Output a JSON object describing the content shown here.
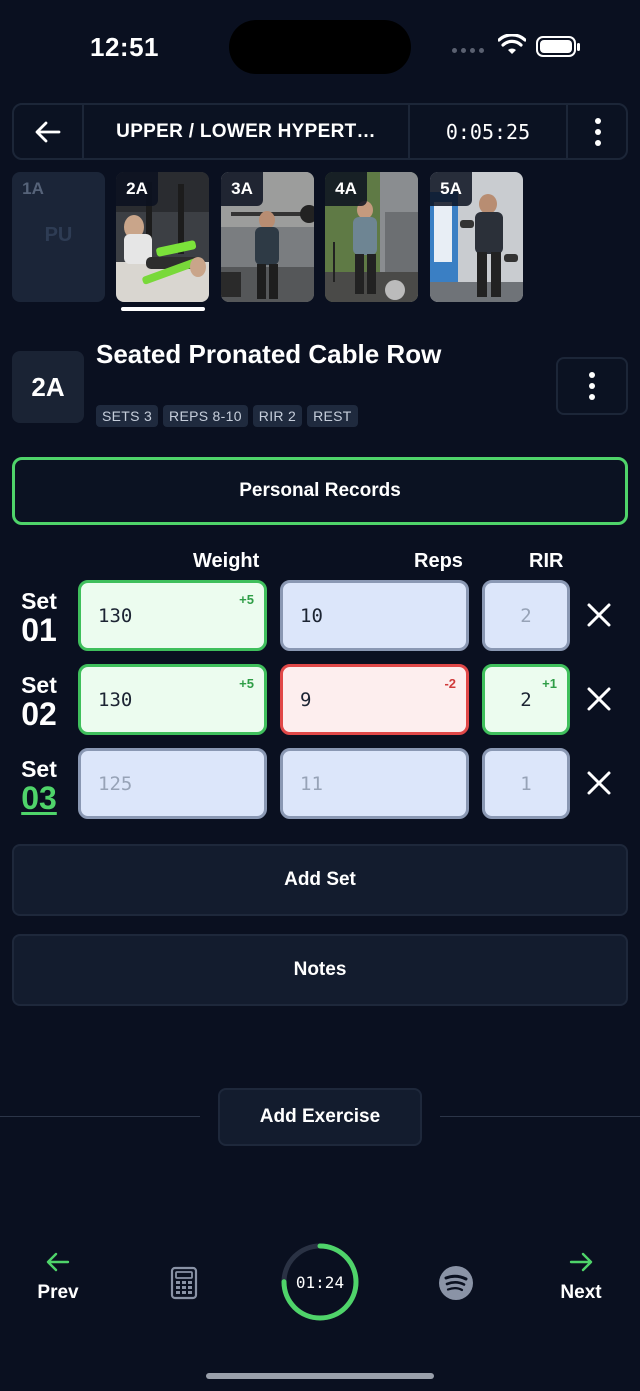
{
  "status_bar": {
    "time": "12:51"
  },
  "header": {
    "title": "UPPER / LOWER HYPERT…",
    "elapsed": "0:05:25"
  },
  "exercises": [
    {
      "label": "1A",
      "placeholder": "PU"
    },
    {
      "label": "2A"
    },
    {
      "label": "3A"
    },
    {
      "label": "4A"
    },
    {
      "label": "5A"
    }
  ],
  "current_exercise": {
    "badge": "2A",
    "name": "Seated Pronated Cable Row",
    "tags": [
      "SETS 3",
      "REPS 8-10",
      "RIR 2",
      "REST"
    ]
  },
  "personal_records_label": "Personal Records",
  "columns": {
    "weight": "Weight",
    "reps": "Reps",
    "rir": "RIR"
  },
  "sets": [
    {
      "word": "Set",
      "number": "01",
      "weight": "130",
      "weight_delta": "+5",
      "reps": "10",
      "reps_delta": "",
      "rir": "2",
      "rir_delta": ""
    },
    {
      "word": "Set",
      "number": "02",
      "weight": "130",
      "weight_delta": "+5",
      "reps": "9",
      "reps_delta": "-2",
      "rir": "2",
      "rir_delta": "+1"
    },
    {
      "word": "Set",
      "number": "03",
      "weight": "",
      "weight_placeholder": "125",
      "reps": "",
      "reps_placeholder": "11",
      "rir": "",
      "rir_placeholder": "1"
    }
  ],
  "add_set_label": "Add Set",
  "notes_label": "Notes",
  "add_exercise_label": "Add Exercise",
  "bottom_nav": {
    "prev": "Prev",
    "next": "Next",
    "rest_timer": "01:24",
    "rest_progress": 0.75
  },
  "colors": {
    "accent_green": "#4fd46a",
    "error_red": "#e04848",
    "background": "#0a1020"
  }
}
